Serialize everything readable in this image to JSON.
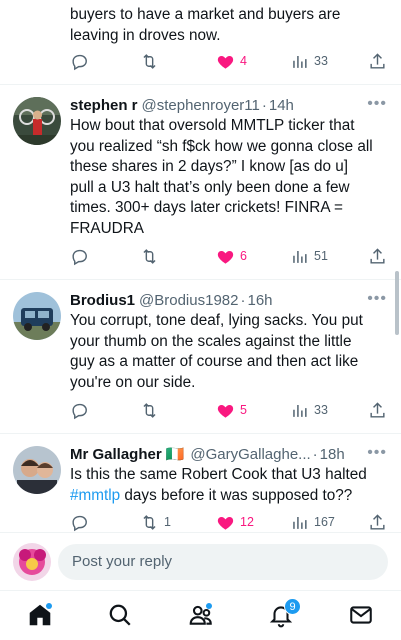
{
  "tweets": [
    {
      "text": "buyers to have a market and buyers are\nleaving in droves now.",
      "actions": {
        "reply": "",
        "retweet": "",
        "like": "4",
        "views": "33"
      }
    },
    {
      "name": "stephen r",
      "handle": "@stephenroyer11",
      "time": "14h",
      "text": "How bout that oversold MMTLP ticker that\nyou realized “sh f$ck how we gonna close all\nthese shares in 2 days?”  I know [as do u]\npull a U3 halt that’s only been done a few\ntimes.  300+ days later crickets!  FINRA =\nFRAUDRA",
      "actions": {
        "reply": "",
        "retweet": "",
        "like": "6",
        "views": "51"
      }
    },
    {
      "name": "Brodius1",
      "handle": "@Brodius1982",
      "time": "16h",
      "text": "You corrupt, tone deaf, lying sacks. You put\nyour thumb on the scales against the little\nguy as a matter of course and then act like\nyou're on our side.",
      "actions": {
        "reply": "",
        "retweet": "",
        "like": "5",
        "views": "33"
      }
    },
    {
      "name": "Mr Gallagher",
      "flag": "🇮🇪",
      "handle": "@GaryGallaghe...",
      "time": "18h",
      "text_main": "Is this the same Robert Cook that U3 halted",
      "hashtag": "#mmtlp",
      "text_tail": " days before it was supposed to??",
      "actions": {
        "reply": "",
        "retweet": "1",
        "like": "12",
        "views": "167"
      }
    }
  ],
  "separator": "·",
  "more_glyph": "•••",
  "composer": {
    "placeholder": "Post your reply"
  },
  "nav": {
    "notifications_badge": "9"
  },
  "colors": {
    "accent": "#1d9bf0",
    "like": "#f91880",
    "muted": "#536471"
  }
}
